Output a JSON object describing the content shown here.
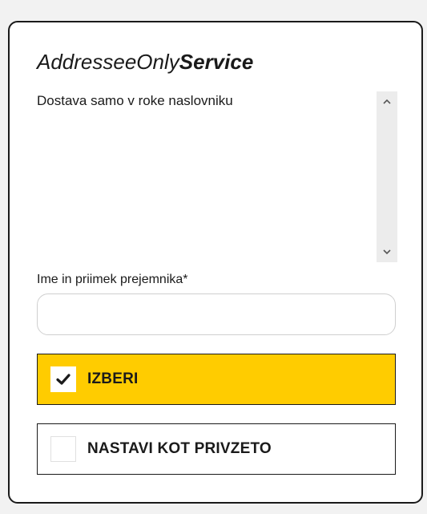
{
  "service": {
    "title_part1": "AddresseeOnly",
    "title_part2": "Service",
    "description": "Dostava samo v roke naslovniku"
  },
  "recipient_field": {
    "label": "Ime in priimek prejemnika*",
    "value": "",
    "placeholder": ""
  },
  "options": {
    "select_label": "IZBERI",
    "select_checked": true,
    "continue_label": "NASTAVI KOT PRIVZETO",
    "continue_checked": false
  },
  "colors": {
    "accent": "#ffcc00",
    "border": "#1a1a1a"
  },
  "icons": {
    "scroll_up": "chevron-up-icon",
    "scroll_down": "chevron-down-icon",
    "check": "checkmark-icon"
  }
}
